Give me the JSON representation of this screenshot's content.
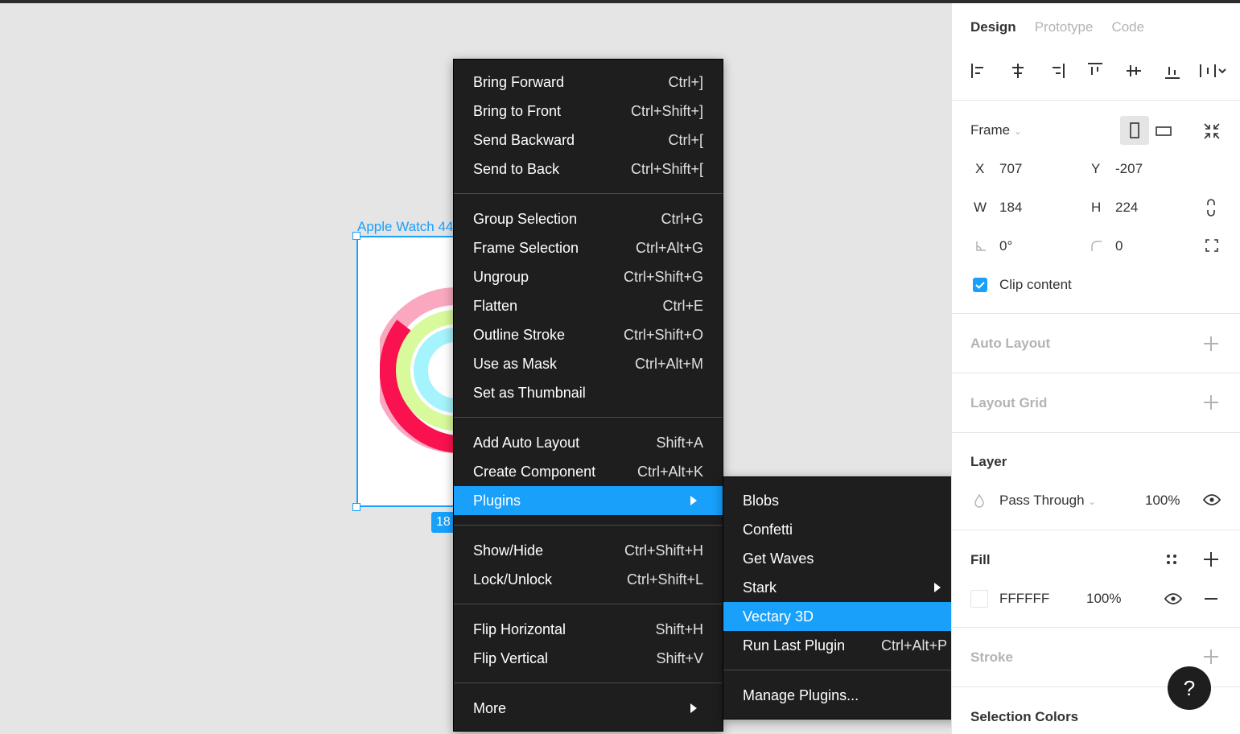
{
  "canvas": {
    "frame_label": "Apple Watch 44",
    "size_badge": "18"
  },
  "context_menu": {
    "groups": [
      [
        {
          "label": "Bring Forward",
          "shortcut": "Ctrl+]"
        },
        {
          "label": "Bring to Front",
          "shortcut": "Ctrl+Shift+]"
        },
        {
          "label": "Send Backward",
          "shortcut": "Ctrl+["
        },
        {
          "label": "Send to Back",
          "shortcut": "Ctrl+Shift+["
        }
      ],
      [
        {
          "label": "Group Selection",
          "shortcut": "Ctrl+G"
        },
        {
          "label": "Frame Selection",
          "shortcut": "Ctrl+Alt+G"
        },
        {
          "label": "Ungroup",
          "shortcut": "Ctrl+Shift+G"
        },
        {
          "label": "Flatten",
          "shortcut": "Ctrl+E"
        },
        {
          "label": "Outline Stroke",
          "shortcut": "Ctrl+Shift+O"
        },
        {
          "label": "Use as Mask",
          "shortcut": "Ctrl+Alt+M"
        },
        {
          "label": "Set as Thumbnail",
          "shortcut": ""
        }
      ],
      [
        {
          "label": "Add Auto Layout",
          "shortcut": "Shift+A"
        },
        {
          "label": "Create Component",
          "shortcut": "Ctrl+Alt+K"
        },
        {
          "label": "Plugins",
          "shortcut": "",
          "submenu": true,
          "active": true
        }
      ],
      [
        {
          "label": "Show/Hide",
          "shortcut": "Ctrl+Shift+H"
        },
        {
          "label": "Lock/Unlock",
          "shortcut": "Ctrl+Shift+L"
        }
      ],
      [
        {
          "label": "Flip Horizontal",
          "shortcut": "Shift+H"
        },
        {
          "label": "Flip Vertical",
          "shortcut": "Shift+V"
        }
      ],
      [
        {
          "label": "More",
          "shortcut": "",
          "submenu": true
        }
      ]
    ]
  },
  "plugins_submenu": {
    "groups": [
      [
        {
          "label": "Blobs",
          "shortcut": ""
        },
        {
          "label": "Confetti",
          "shortcut": ""
        },
        {
          "label": "Get Waves",
          "shortcut": ""
        },
        {
          "label": "Stark",
          "shortcut": "",
          "submenu": true
        },
        {
          "label": "Vectary 3D",
          "shortcut": "",
          "active": true
        },
        {
          "label": "Run Last Plugin",
          "shortcut": "Ctrl+Alt+P"
        }
      ],
      [
        {
          "label": "Manage Plugins...",
          "shortcut": ""
        }
      ]
    ]
  },
  "panel": {
    "tabs": [
      "Design",
      "Prototype",
      "Code"
    ],
    "active_tab": "Design",
    "frame": {
      "label": "Frame",
      "x_label": "X",
      "x": "707",
      "y_label": "Y",
      "y": "-207",
      "w_label": "W",
      "w": "184",
      "h_label": "H",
      "h": "224",
      "rotation": "0°",
      "radius": "0",
      "clip_content": "Clip content"
    },
    "auto_layout": "Auto Layout",
    "layout_grid": "Layout Grid",
    "layer": {
      "title": "Layer",
      "blend": "Pass Through",
      "opacity": "100%"
    },
    "fill": {
      "title": "Fill",
      "hex": "FFFFFF",
      "opacity": "100%"
    },
    "stroke": "Stroke",
    "selection_colors": "Selection Colors",
    "help": "?"
  },
  "colors": {
    "accent": "#18a0fb",
    "menu_bg": "#1e1e1e",
    "ring_outer": "#fa114f",
    "ring_middle": "#a6ff00",
    "ring_inner": "#00f0ff"
  }
}
